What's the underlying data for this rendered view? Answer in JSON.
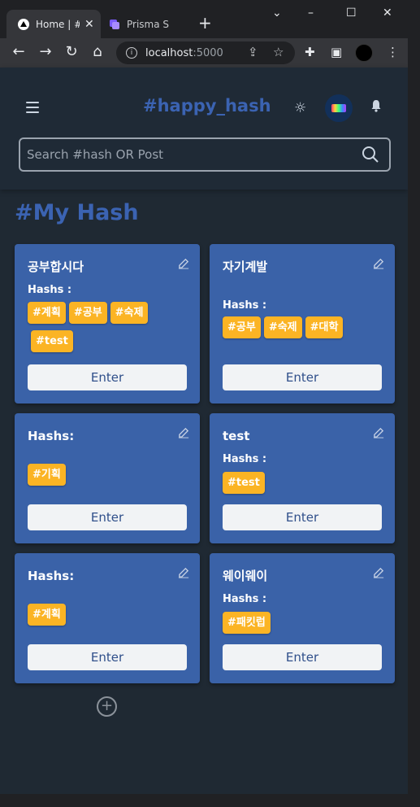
{
  "browser": {
    "tabs": [
      {
        "label": "Home | #",
        "active": true
      },
      {
        "label": "Prisma S",
        "active": false
      }
    ],
    "url_host": "localhost",
    "url_port": ":5000"
  },
  "header": {
    "logo": "#happy_hash",
    "search_placeholder": "Search #hash OR Post"
  },
  "section_title": "#My Hash",
  "cards": [
    {
      "title": "공부합시다",
      "hash_label": "Hashs :",
      "tags": [
        "#계획",
        "#공부",
        "#숙제",
        "#test"
      ],
      "button": "Enter"
    },
    {
      "title": "자기계발",
      "hash_label": "Hashs :",
      "tags": [
        "#공부",
        "#숙제",
        "#대학"
      ],
      "button": "Enter"
    },
    {
      "title": "Hashs:",
      "hash_label": "",
      "tags": [
        "#기획"
      ],
      "button": "Enter"
    },
    {
      "title": "test",
      "hash_label": "Hashs :",
      "tags": [
        "#test"
      ],
      "button": "Enter"
    },
    {
      "title": "Hashs:",
      "hash_label": "",
      "tags": [
        "#계획"
      ],
      "button": "Enter"
    },
    {
      "title": "웨이웨이",
      "hash_label": "Hashs :",
      "tags": [
        "#패킷럽"
      ],
      "button": "Enter"
    }
  ],
  "colors": {
    "brand": "#3b63b2",
    "card": "#3a62a8",
    "tag": "#fbb424",
    "background": "#1f2933"
  },
  "icons": [
    "menu-icon",
    "sun-icon",
    "bell-icon",
    "search-icon",
    "edit-icon",
    "add-circle-icon"
  ]
}
